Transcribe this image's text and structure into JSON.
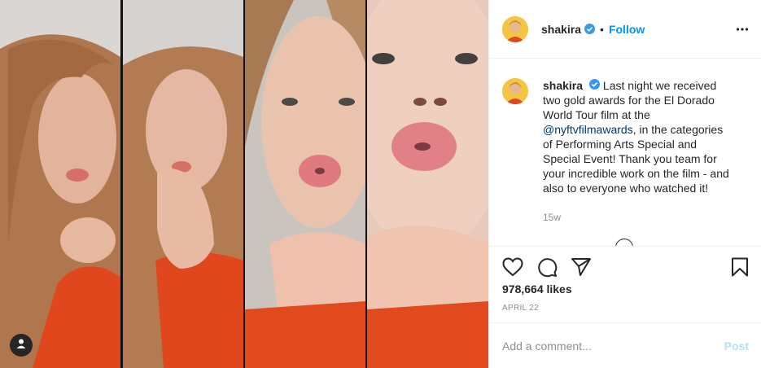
{
  "post": {
    "username": "shakira",
    "follow_label": "Follow",
    "separator": "•",
    "caption_username": "shakira",
    "caption_before_mention": " Last night we received two gold awards for the El Dorado World Tour film at the ",
    "mention": "@nyftvfilmawards",
    "caption_after_mention": ", in the categories of Performing Arts Special and Special Event! Thank you team for your incredible work on the film - and also to everyone who watched it!",
    "time_ago": "15w",
    "likes": "978,664 likes",
    "date": "APRIL 22",
    "comment_placeholder": "Add a comment...",
    "post_label": "Post"
  },
  "icons": {
    "verified": "verified-badge-icon",
    "more": "more-options-icon",
    "like": "heart-icon",
    "comment": "comment-icon",
    "share": "share-icon",
    "save": "bookmark-icon",
    "user_tag": "user-tag-icon"
  },
  "colors": {
    "accent": "#0095f6",
    "mention": "#00376b",
    "muted": "#8e8e8e",
    "post_disabled": "#b2dffc",
    "text": "#262626",
    "border": "#efefef"
  }
}
